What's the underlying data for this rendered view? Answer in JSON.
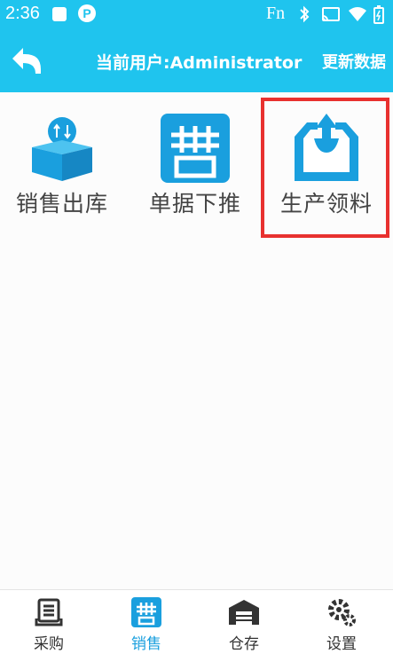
{
  "status_bar": {
    "time": "2:36",
    "extra": "Fn"
  },
  "app_bar": {
    "user_label": "当前用户:Administrator",
    "refresh_label": "更新数据"
  },
  "tiles": [
    {
      "label": "销售出库",
      "icon": "box-download-icon"
    },
    {
      "label": "单据下推",
      "icon": "document-push-icon"
    },
    {
      "label": "生产领料",
      "icon": "tray-upload-icon"
    }
  ],
  "bottom_nav": [
    {
      "label": "采购",
      "icon": "purchase-icon",
      "active": false
    },
    {
      "label": "销售",
      "icon": "sales-icon",
      "active": true
    },
    {
      "label": "仓存",
      "icon": "warehouse-icon",
      "active": false
    },
    {
      "label": "设置",
      "icon": "settings-icon",
      "active": false
    }
  ],
  "colors": {
    "primary": "#1fc4ee",
    "icon_blue": "#1a9fde",
    "highlight": "#e8312f"
  }
}
